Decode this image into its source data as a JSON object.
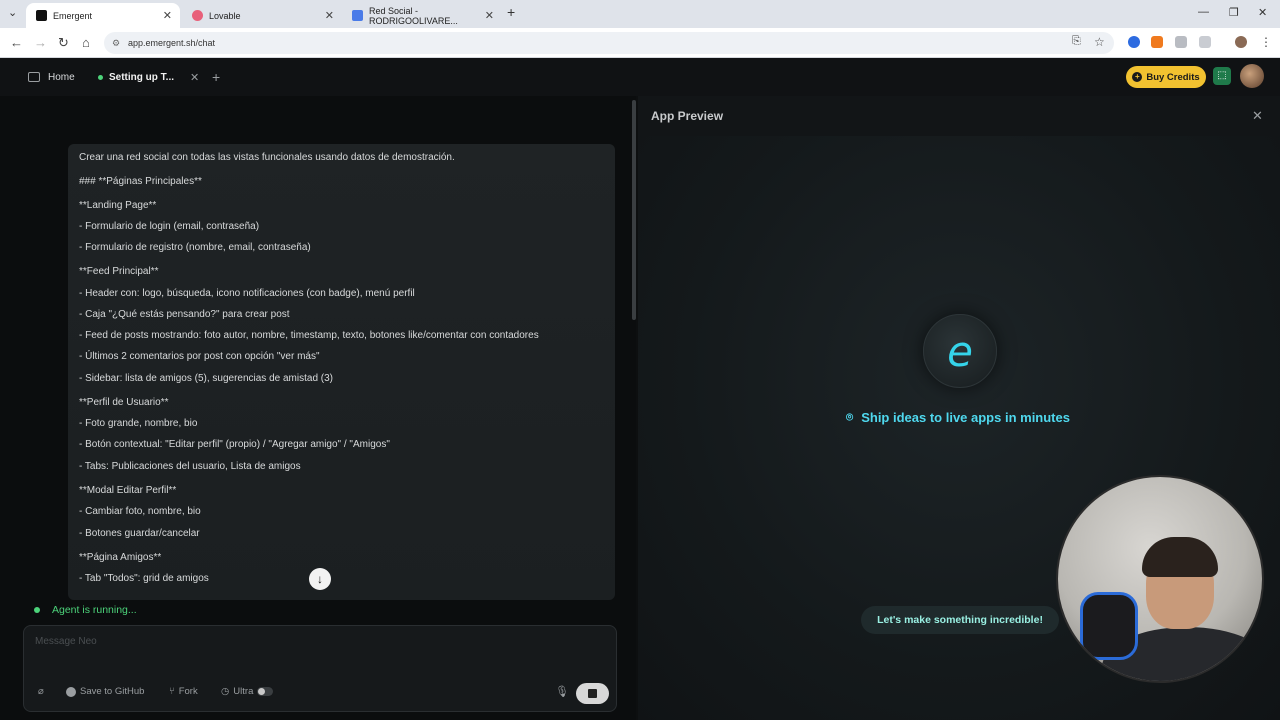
{
  "browser": {
    "tabs": [
      {
        "label": "Emergent",
        "fav_color": "#111111"
      },
      {
        "label": "Lovable",
        "fav_color": "#e8607a"
      },
      {
        "label": "Red Social - RODRIGOOLIVARE...",
        "fav_color": "#4a7be8"
      }
    ],
    "url": "app.emergent.sh/chat"
  },
  "app": {
    "home_label": "Home",
    "active_tab_label": "Setting up T...",
    "buy_credits_label": "Buy Credits"
  },
  "chat": {
    "lines": [
      "Crear una red social con todas las vistas funcionales usando datos de demostración.",
      "### **Páginas Principales**",
      "**Landing Page**",
      "- Formulario de login (email, contraseña)",
      "- Formulario de registro (nombre, email, contraseña)",
      "**Feed Principal**",
      "- Header con: logo, búsqueda, icono notificaciones (con badge), menú perfil",
      "- Caja \"¿Qué estás pensando?\" para crear post",
      "- Feed de posts mostrando: foto autor, nombre, timestamp, texto, botones like/comentar con contadores",
      "- Últimos 2 comentarios por post con opción \"ver más\"",
      "- Sidebar: lista de amigos (5), sugerencias de amistad (3)",
      "**Perfil de Usuario**",
      "- Foto grande, nombre, bio",
      "- Botón contextual: \"Editar perfil\" (propio) / \"Agregar amigo\" / \"Amigos\"",
      "- Tabs: Publicaciones del usuario, Lista de amigos",
      "**Modal Editar Perfil**",
      "- Cambiar foto, nombre, bio",
      "- Botones guardar/cancelar",
      "**Página Amigos**",
      "- Tab \"Todos\": grid de amigos"
    ],
    "status": "Agent is running...",
    "composer_placeholder": "Message Neo",
    "buttons": {
      "github": "Save to GitHub",
      "fork": "Fork",
      "ultra": "Ultra"
    }
  },
  "preview": {
    "title": "App Preview",
    "tagline": "Ship ideas to live apps in minutes",
    "pill": "Let's make something incredible!"
  },
  "colors": {
    "accent": "#35d4ea",
    "status_green": "#4cd37a",
    "credits_yellow": "#f2c230"
  }
}
